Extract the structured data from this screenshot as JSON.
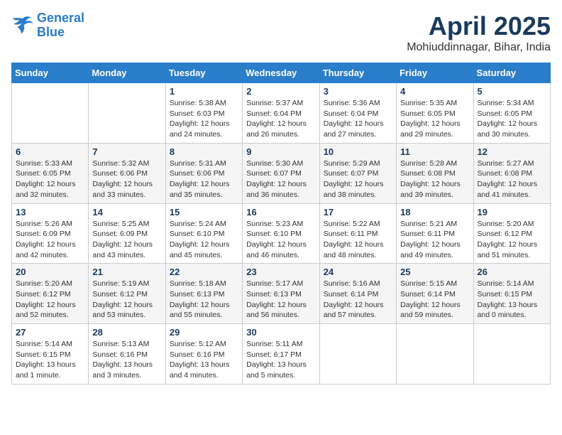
{
  "header": {
    "logo_line1": "General",
    "logo_line2": "Blue",
    "month_title": "April 2025",
    "location": "Mohiuddinnagar, Bihar, India"
  },
  "days_of_week": [
    "Sunday",
    "Monday",
    "Tuesday",
    "Wednesday",
    "Thursday",
    "Friday",
    "Saturday"
  ],
  "weeks": [
    [
      {
        "day": "",
        "info": ""
      },
      {
        "day": "",
        "info": ""
      },
      {
        "day": "1",
        "info": "Sunrise: 5:38 AM\nSunset: 6:03 PM\nDaylight: 12 hours\nand 24 minutes."
      },
      {
        "day": "2",
        "info": "Sunrise: 5:37 AM\nSunset: 6:04 PM\nDaylight: 12 hours\nand 26 minutes."
      },
      {
        "day": "3",
        "info": "Sunrise: 5:36 AM\nSunset: 6:04 PM\nDaylight: 12 hours\nand 27 minutes."
      },
      {
        "day": "4",
        "info": "Sunrise: 5:35 AM\nSunset: 6:05 PM\nDaylight: 12 hours\nand 29 minutes."
      },
      {
        "day": "5",
        "info": "Sunrise: 5:34 AM\nSunset: 6:05 PM\nDaylight: 12 hours\nand 30 minutes."
      }
    ],
    [
      {
        "day": "6",
        "info": "Sunrise: 5:33 AM\nSunset: 6:05 PM\nDaylight: 12 hours\nand 32 minutes."
      },
      {
        "day": "7",
        "info": "Sunrise: 5:32 AM\nSunset: 6:06 PM\nDaylight: 12 hours\nand 33 minutes."
      },
      {
        "day": "8",
        "info": "Sunrise: 5:31 AM\nSunset: 6:06 PM\nDaylight: 12 hours\nand 35 minutes."
      },
      {
        "day": "9",
        "info": "Sunrise: 5:30 AM\nSunset: 6:07 PM\nDaylight: 12 hours\nand 36 minutes."
      },
      {
        "day": "10",
        "info": "Sunrise: 5:29 AM\nSunset: 6:07 PM\nDaylight: 12 hours\nand 38 minutes."
      },
      {
        "day": "11",
        "info": "Sunrise: 5:28 AM\nSunset: 6:08 PM\nDaylight: 12 hours\nand 39 minutes."
      },
      {
        "day": "12",
        "info": "Sunrise: 5:27 AM\nSunset: 6:08 PM\nDaylight: 12 hours\nand 41 minutes."
      }
    ],
    [
      {
        "day": "13",
        "info": "Sunrise: 5:26 AM\nSunset: 6:09 PM\nDaylight: 12 hours\nand 42 minutes."
      },
      {
        "day": "14",
        "info": "Sunrise: 5:25 AM\nSunset: 6:09 PM\nDaylight: 12 hours\nand 43 minutes."
      },
      {
        "day": "15",
        "info": "Sunrise: 5:24 AM\nSunset: 6:10 PM\nDaylight: 12 hours\nand 45 minutes."
      },
      {
        "day": "16",
        "info": "Sunrise: 5:23 AM\nSunset: 6:10 PM\nDaylight: 12 hours\nand 46 minutes."
      },
      {
        "day": "17",
        "info": "Sunrise: 5:22 AM\nSunset: 6:11 PM\nDaylight: 12 hours\nand 48 minutes."
      },
      {
        "day": "18",
        "info": "Sunrise: 5:21 AM\nSunset: 6:11 PM\nDaylight: 12 hours\nand 49 minutes."
      },
      {
        "day": "19",
        "info": "Sunrise: 5:20 AM\nSunset: 6:12 PM\nDaylight: 12 hours\nand 51 minutes."
      }
    ],
    [
      {
        "day": "20",
        "info": "Sunrise: 5:20 AM\nSunset: 6:12 PM\nDaylight: 12 hours\nand 52 minutes."
      },
      {
        "day": "21",
        "info": "Sunrise: 5:19 AM\nSunset: 6:12 PM\nDaylight: 12 hours\nand 53 minutes."
      },
      {
        "day": "22",
        "info": "Sunrise: 5:18 AM\nSunset: 6:13 PM\nDaylight: 12 hours\nand 55 minutes."
      },
      {
        "day": "23",
        "info": "Sunrise: 5:17 AM\nSunset: 6:13 PM\nDaylight: 12 hours\nand 56 minutes."
      },
      {
        "day": "24",
        "info": "Sunrise: 5:16 AM\nSunset: 6:14 PM\nDaylight: 12 hours\nand 57 minutes."
      },
      {
        "day": "25",
        "info": "Sunrise: 5:15 AM\nSunset: 6:14 PM\nDaylight: 12 hours\nand 59 minutes."
      },
      {
        "day": "26",
        "info": "Sunrise: 5:14 AM\nSunset: 6:15 PM\nDaylight: 13 hours\nand 0 minutes."
      }
    ],
    [
      {
        "day": "27",
        "info": "Sunrise: 5:14 AM\nSunset: 6:15 PM\nDaylight: 13 hours\nand 1 minute."
      },
      {
        "day": "28",
        "info": "Sunrise: 5:13 AM\nSunset: 6:16 PM\nDaylight: 13 hours\nand 3 minutes."
      },
      {
        "day": "29",
        "info": "Sunrise: 5:12 AM\nSunset: 6:16 PM\nDaylight: 13 hours\nand 4 minutes."
      },
      {
        "day": "30",
        "info": "Sunrise: 5:11 AM\nSunset: 6:17 PM\nDaylight: 13 hours\nand 5 minutes."
      },
      {
        "day": "",
        "info": ""
      },
      {
        "day": "",
        "info": ""
      },
      {
        "day": "",
        "info": ""
      }
    ]
  ]
}
